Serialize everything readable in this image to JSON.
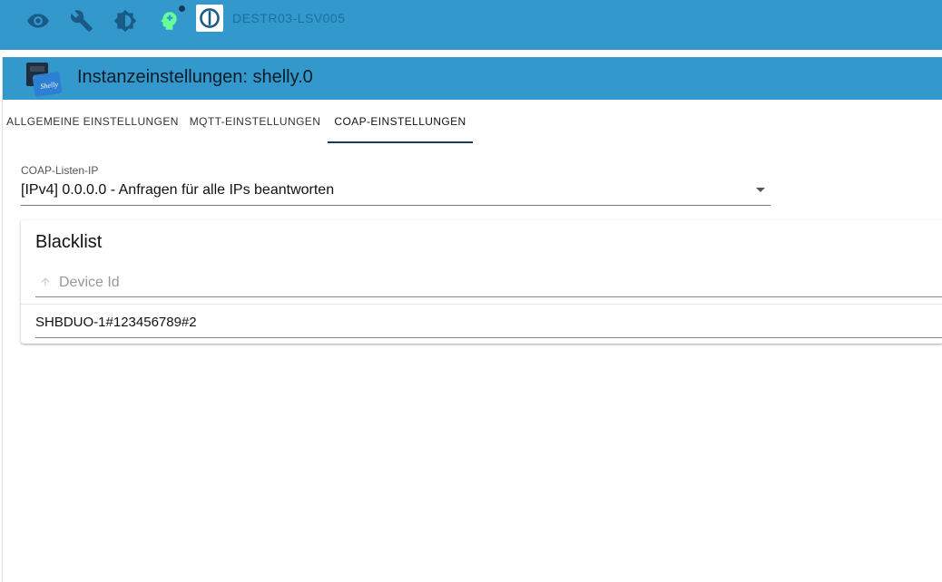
{
  "topbar": {
    "icons": [
      "eye-icon",
      "wrench-icon",
      "brightness-icon",
      "expert-mode-icon"
    ],
    "host_name": "DESTR03-LSV005"
  },
  "dialog": {
    "title": "Instanzeinstellungen: shelly.0",
    "adapter_logo_text": "Shelly"
  },
  "tabs": [
    {
      "label": "ALLGEMEINE EINSTELLUNGEN"
    },
    {
      "label": "MQTT-EINSTELLUNGEN"
    },
    {
      "label": "COAP-EINSTELLUNGEN"
    }
  ],
  "coap": {
    "listen_ip_label": "COAP-Listen-IP",
    "listen_ip_value": "[IPv4] 0.0.0.0 - Anfragen für alle IPs beantworten"
  },
  "blacklist": {
    "title": "Blacklist",
    "column_header": "Device Id",
    "rows": [
      {
        "device_id": "SHBDUO-1#123456789#2"
      }
    ]
  },
  "colors": {
    "primary": "#3399cc",
    "tab_indicator": "#163a5a",
    "expert_icon": "#66ff99"
  }
}
